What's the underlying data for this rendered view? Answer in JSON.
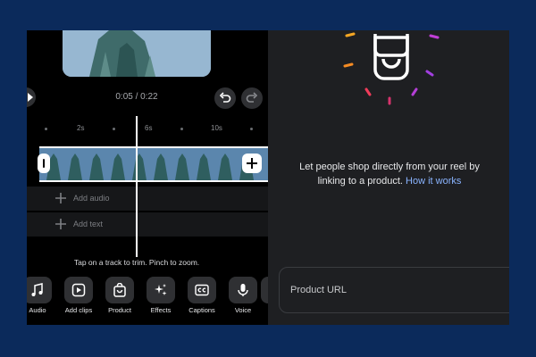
{
  "editor": {
    "timecode": "0:05 / 0:22",
    "ruler_labels": [
      "2s",
      "6s",
      "10s"
    ],
    "tracks": {
      "add_audio": "Add audio",
      "add_text": "Add text"
    },
    "hint": "Tap on a track to trim. Pinch to zoom.",
    "tools": [
      {
        "label": "Audio",
        "icon": "music-note-icon"
      },
      {
        "label": "Add clips",
        "icon": "add-clip-icon"
      },
      {
        "label": "Product",
        "icon": "shopping-bag-icon"
      },
      {
        "label": "Effects",
        "icon": "sparkles-icon"
      },
      {
        "label": "Captions",
        "icon": "captions-icon"
      },
      {
        "label": "Voice",
        "icon": "microphone-icon"
      }
    ]
  },
  "product_panel": {
    "promo_text": "Let people shop directly from your reel by linking to a product.",
    "how_it_works": "How it works",
    "url_placeholder": "Product URL"
  },
  "colors": {
    "background": "#0b2a5b",
    "link": "#8ab4ff",
    "panel": "#1e1f22"
  }
}
